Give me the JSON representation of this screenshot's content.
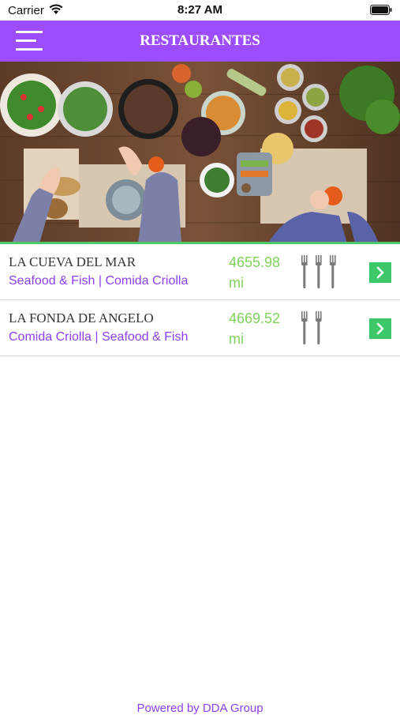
{
  "status_bar": {
    "carrier": "Carrier",
    "time": "8:27 AM"
  },
  "nav": {
    "title": "RESTAURANTES"
  },
  "restaurants": [
    {
      "name": "LA CUEVA DEL MAR",
      "categories": "Seafood & Fish | Comida Criolla",
      "distance_value": "4655.98",
      "distance_unit": "mi",
      "price_level": 3
    },
    {
      "name": "LA FONDA DE ANGELO",
      "categories": "Comida Criolla | Seafood & Fish",
      "distance_value": "4669.52",
      "distance_unit": "mi",
      "price_level": 2
    }
  ],
  "footer": {
    "text": "Powered by DDA Group"
  },
  "colors": {
    "accent": "#9b4dff",
    "distance": "#7fd15c",
    "arrow": "#3fc86a"
  }
}
